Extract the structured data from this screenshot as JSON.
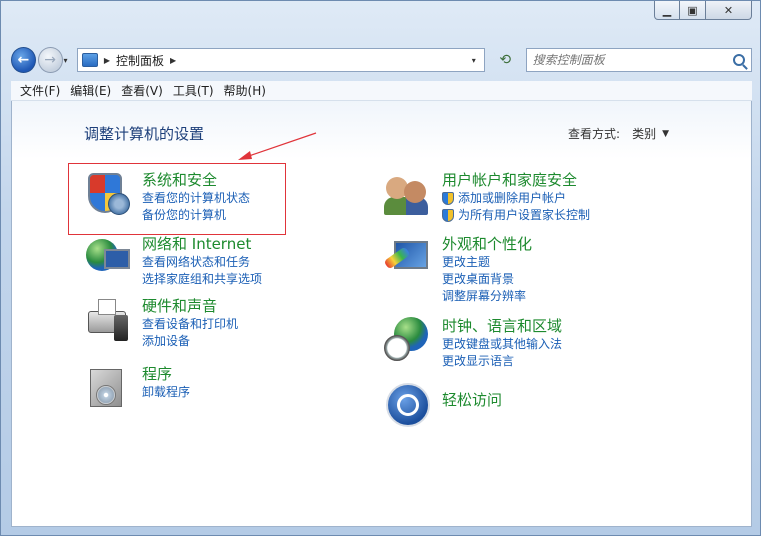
{
  "window": {
    "caption_buttons": {
      "min_icon": "minimize-icon",
      "max_icon": "maximize-icon",
      "close_icon": "close-icon",
      "min_glyph": "▁",
      "max_glyph": "▣",
      "close_glyph": "✕"
    }
  },
  "nav": {
    "back_glyph": "←",
    "forward_glyph": "→",
    "history_glyph": "▾",
    "breadcrumb_sep": "▶",
    "address_text": "控制面板",
    "address_trailing_sep": "▶",
    "address_dropdown_glyph": "▾",
    "refresh_glyph": "⟲",
    "search_placeholder": "搜索控制面板"
  },
  "menubar": {
    "items": [
      "文件(F)",
      "编辑(E)",
      "查看(V)",
      "工具(T)",
      "帮助(H)"
    ]
  },
  "content": {
    "title": "调整计算机的设置",
    "view_by_label": "查看方式:",
    "view_by_value": "类别",
    "view_by_caret": "▼",
    "accent_red": "#e0343a"
  },
  "categories": {
    "system": {
      "title": "系统和安全",
      "links": [
        "查看您的计算机状态",
        "备份您的计算机"
      ]
    },
    "network": {
      "title": "网络和 Internet",
      "links": [
        "查看网络状态和任务",
        "选择家庭组和共享选项"
      ]
    },
    "hardware": {
      "title": "硬件和声音",
      "links": [
        "查看设备和打印机",
        "添加设备"
      ]
    },
    "programs": {
      "title": "程序",
      "links": [
        "卸载程序"
      ]
    },
    "users": {
      "title": "用户帐户和家庭安全",
      "links": [
        "添加或删除用户帐户",
        "为所有用户设置家长控制"
      ]
    },
    "appearance": {
      "title": "外观和个性化",
      "links": [
        "更改主题",
        "更改桌面背景",
        "调整屏幕分辨率"
      ]
    },
    "clock": {
      "title": "时钟、语言和区域",
      "links": [
        "更改键盘或其他输入法",
        "更改显示语言"
      ]
    },
    "ease": {
      "title": "轻松访问",
      "links": []
    }
  }
}
